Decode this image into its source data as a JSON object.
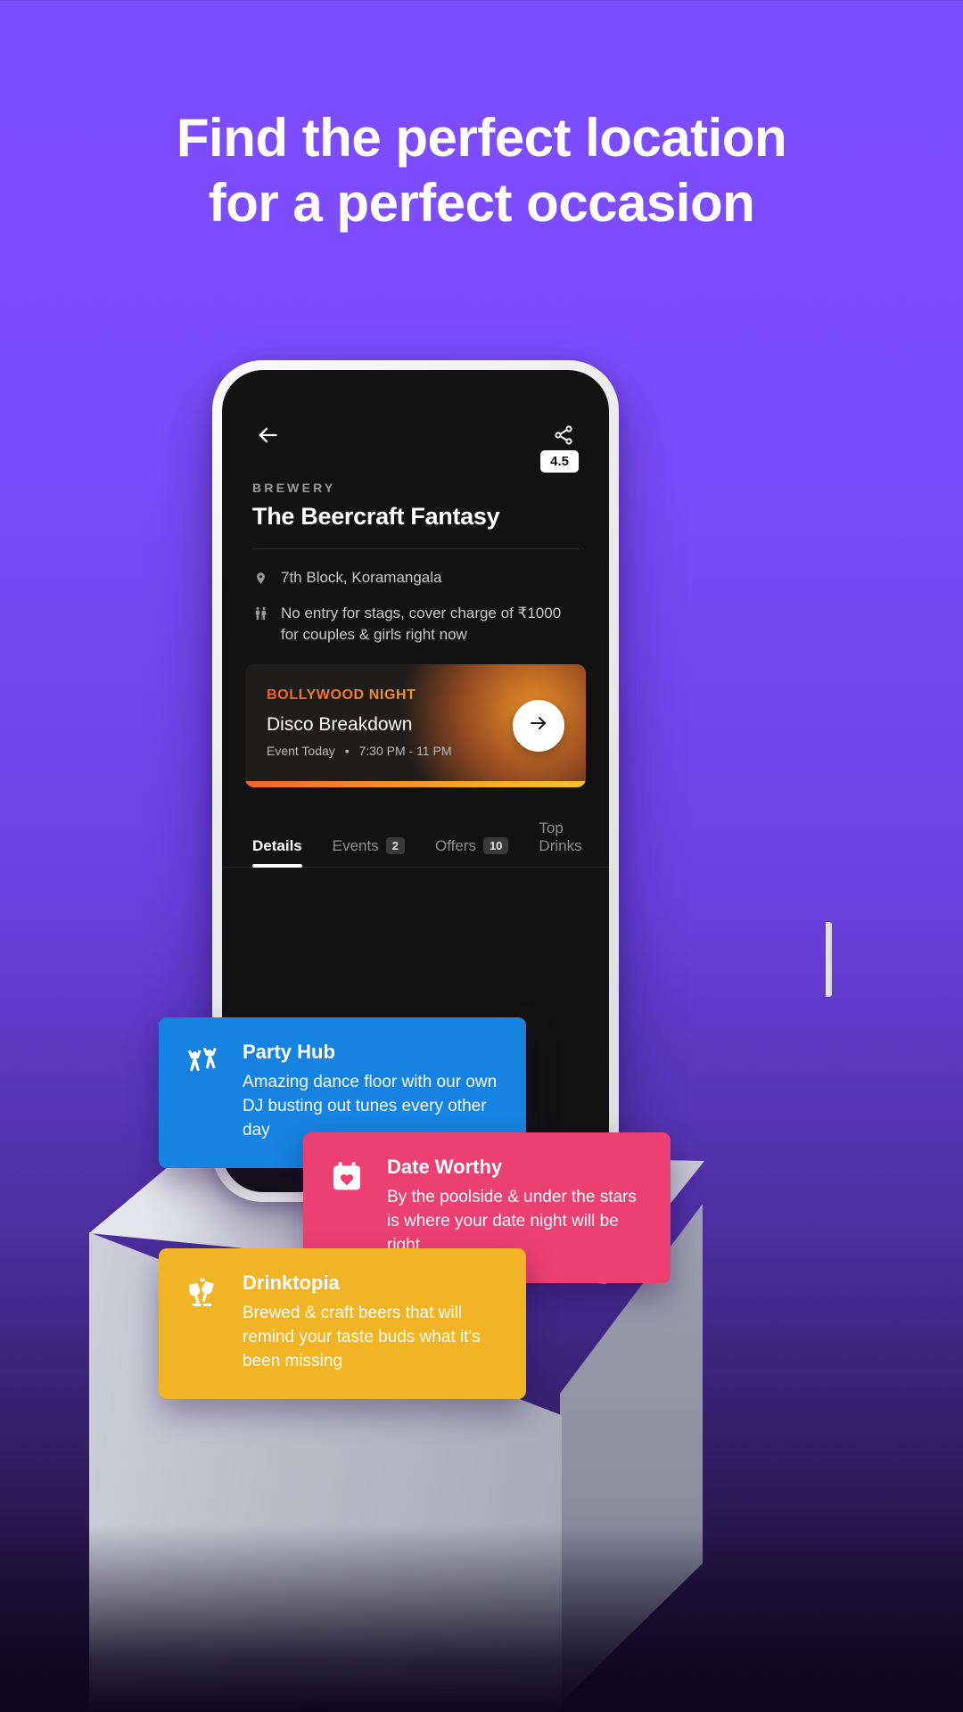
{
  "headline": {
    "line1": "Find the perfect location",
    "line2": "for a perfect occasion"
  },
  "phone": {
    "topbar": {
      "back_icon": "arrow-left-icon",
      "share_icon": "share-icon"
    },
    "venue": {
      "category": "BREWERY",
      "name": "The Beercraft Fantasy",
      "rating": "4.5"
    },
    "meta": [
      {
        "icon": "location-pin-icon",
        "text": "7th Block, Koramangala"
      },
      {
        "icon": "couple-icon",
        "text": "No entry for stags, cover charge of ₹1000 for couples & girls right now"
      }
    ],
    "event": {
      "kicker": "BOLLYWOOD NIGHT",
      "title": "Disco Breakdown",
      "when": "Event Today",
      "separator": "•",
      "time": "7:30 PM - 11 PM",
      "cta_icon": "arrow-right-icon"
    },
    "tabs": [
      {
        "label": "Details",
        "badge": "",
        "active": true
      },
      {
        "label": "Events",
        "badge": "2",
        "active": false
      },
      {
        "label": "Offers",
        "badge": "10",
        "active": false
      },
      {
        "label": "Top Drinks",
        "badge": "",
        "active": false
      }
    ]
  },
  "feature_cards": [
    {
      "icon": "dancing-people-icon",
      "title": "Party Hub",
      "description": "Amazing dance floor with our own DJ busting out tunes every other day",
      "color": "#1683e0"
    },
    {
      "icon": "calendar-heart-icon",
      "title": "Date Worthy",
      "description": "By the poolside & under the stars is where your date night will be right",
      "color": "#ec3f72"
    },
    {
      "icon": "cheers-glasses-icon",
      "title": "Drinktopia",
      "description": "Brewed & craft beers that will remind your taste buds what it's been missing",
      "color": "#f0b424"
    }
  ],
  "colors": {
    "background_purple": "#7c4dff",
    "screen_black": "#121212",
    "accent_orange": "#f2622c",
    "accent_yellow": "#f3c436"
  }
}
